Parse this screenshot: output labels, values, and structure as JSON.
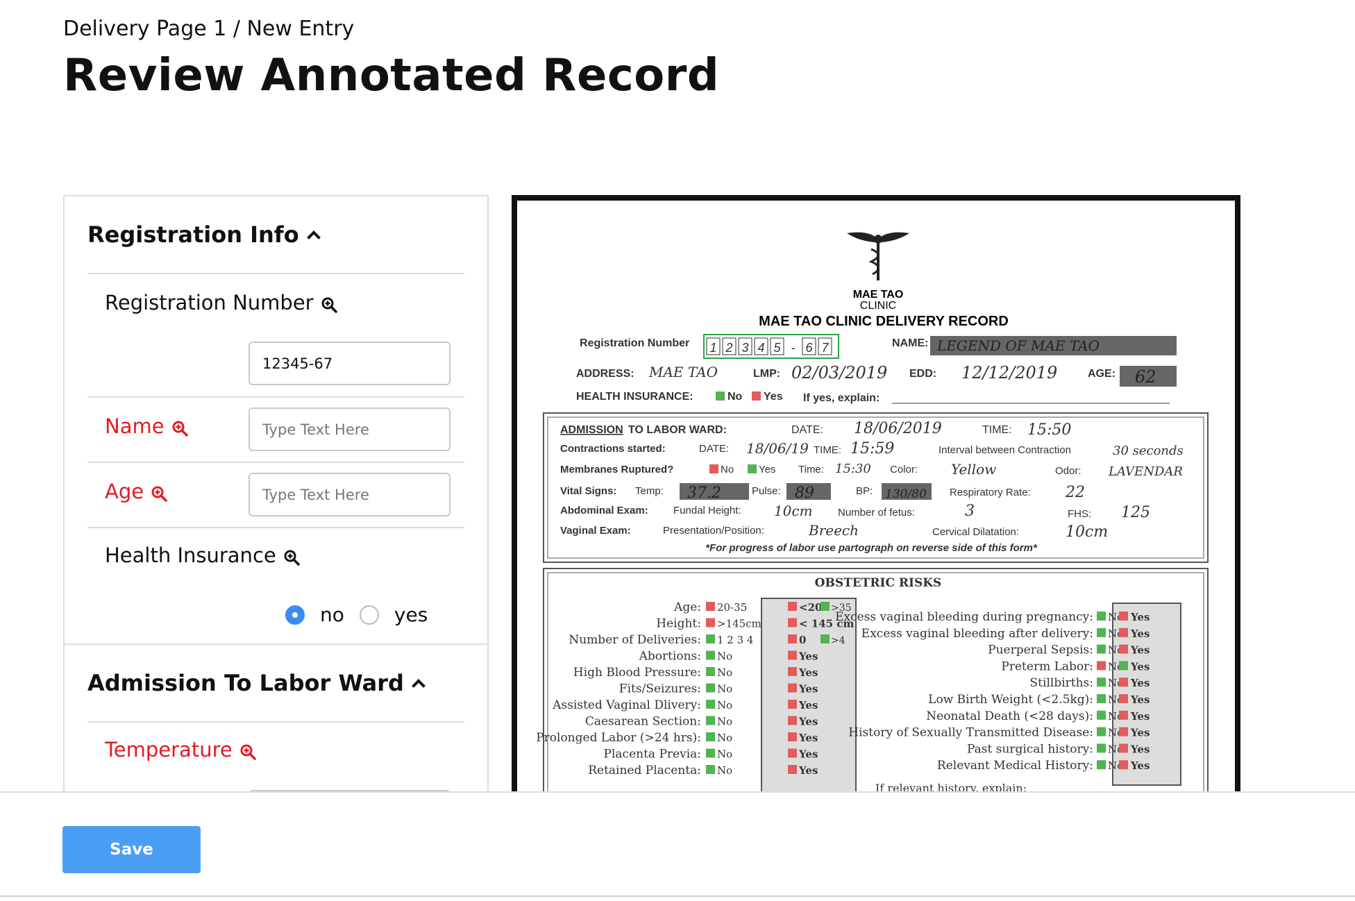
{
  "breadcrumb": "Delivery Page 1 / New Entry",
  "page_title": "Review Annotated Record",
  "registration_section": {
    "title": "Registration Info",
    "fields": {
      "registration_number": {
        "label": "Registration Number",
        "value": "12345-67"
      },
      "name": {
        "label": "Name",
        "placeholder": "Type Text Here"
      },
      "age": {
        "label": "Age",
        "placeholder": "Type Text Here"
      },
      "health_insurance": {
        "label": "Health Insurance",
        "options": [
          "no",
          "yes"
        ],
        "selected": "no"
      }
    }
  },
  "admission_section": {
    "title": "Admission To Labor Ward",
    "fields": {
      "temperature": {
        "label": "Temperature"
      }
    }
  },
  "save_label": "Save",
  "colors": {
    "accent": "#4a9ff5",
    "required": "#e31b23",
    "radio_selected": "#3b8cf2"
  },
  "document": {
    "clinic_name_1": "MAE TAO",
    "clinic_name_2": "CLINIC",
    "form_title": "MAE TAO CLINIC DELIVERY RECORD",
    "reg_label": "Registration Number",
    "reg_boxes": [
      "1",
      "2",
      "3",
      "4",
      "5",
      "-",
      "6",
      "7"
    ],
    "name_label": "NAME:",
    "name_value": "LEGEND OF MAE TAO",
    "address_label": "ADDRESS:",
    "address_value": "MAE TAO",
    "lmp_label": "LMP:",
    "lmp_value": "02/03/2019",
    "edd_label": "EDD:",
    "edd_value": "12/12/2019",
    "age_label": "AGE:",
    "age_value": "62",
    "hi_label": "HEALTH INSURANCE:",
    "hi_no": "No",
    "hi_yes": "Yes",
    "hi_explain": "If yes, explain:",
    "adm_title": "ADMISSION",
    "adm_title_rest": "TO LABOR WARD:",
    "date_label": "DATE:",
    "date_value": "18/06/2019",
    "time_label": "TIME:",
    "time_value": "15:50",
    "contr_label": "Contractions started:",
    "contr_date_label": "DATE:",
    "contr_date": "18/06/19",
    "contr_time_label": "TIME:",
    "contr_time": "15:59",
    "interval_label": "Interval between Contraction",
    "interval_value": "30 seconds",
    "membranes_label": "Membranes Ruptured?",
    "mem_no": "No",
    "mem_yes": "Yes",
    "mem_time_label": "Time:",
    "mem_time": "15:30",
    "color_label": "Color:",
    "color_value": "Yellow",
    "odor_label": "Odor:",
    "odor_value": "LAVENDAR",
    "vital_label": "Vital Signs:",
    "temp_label": "Temp:",
    "temp_value": "37.2",
    "pulse_label": "Pulse:",
    "pulse_value": "89",
    "bp_label": "BP:",
    "bp_value": "130/80",
    "resp_label": "Respiratory Rate:",
    "resp_value": "22",
    "abd_label": "Abdominal Exam:",
    "fundal_label": "Fundal Height:",
    "fundal_value": "10cm",
    "fetus_label": "Number of fetus:",
    "fetus_value": "3",
    "fhs_label": "FHS:",
    "fhs_value": "125",
    "vag_label": "Vaginal Exam:",
    "pres_label": "Presentation/Position:",
    "pres_value": "Breech",
    "cerv_label": "Cervical Dilatation:",
    "cerv_value": "10cm",
    "progress_note": "*For progress of labor use partograph on reverse side of this form*",
    "risks_title": "OBSTETRIC RISKS",
    "risks_left": [
      {
        "label": "Age:",
        "low": "20-35",
        "high": "<20",
        "high2": ">35"
      },
      {
        "label": "Height:",
        "low": ">145cm",
        "high": "< 145 cm"
      },
      {
        "label": "Number of Deliveries:",
        "low": "1 2 3 4",
        "high": "0",
        "high2": ">4"
      },
      {
        "label": "Abortions:",
        "low": "No",
        "high": "Yes"
      },
      {
        "label": "High Blood Pressure:",
        "low": "No",
        "high": "Yes"
      },
      {
        "label": "Fits/Seizures:",
        "low": "No",
        "high": "Yes"
      },
      {
        "label": "Assisted Vaginal Dlivery:",
        "low": "No",
        "high": "Yes"
      },
      {
        "label": "Caesarean Section:",
        "low": "No",
        "high": "Yes"
      },
      {
        "label": "Prolonged Labor (>24 hrs):",
        "low": "No",
        "high": "Yes"
      },
      {
        "label": "Placenta Previa:",
        "low": "No",
        "high": "Yes"
      },
      {
        "label": "Retained Placenta:",
        "low": "No",
        "high": "Yes"
      }
    ],
    "risks_right": [
      {
        "label": "Excess vaginal bleeding during pregnancy:",
        "low": "No",
        "high": "Yes"
      },
      {
        "label": "Excess vaginal bleeding after delivery:",
        "low": "No",
        "high": "Yes"
      },
      {
        "label": "Puerperal Sepsis:",
        "low": "No",
        "high": "Yes"
      },
      {
        "label": "Preterm Labor:",
        "low": "No",
        "high": "Yes"
      },
      {
        "label": "Stillbirths:",
        "low": "No",
        "high": "Yes"
      },
      {
        "label": "Low Birth Weight (<2.5kg):",
        "low": "No",
        "high": "Yes"
      },
      {
        "label": "Neonatal Death (<28 days):",
        "low": "No",
        "high": "Yes"
      },
      {
        "label": "History of Sexually Transmitted Disease:",
        "low": "No",
        "high": "Yes"
      },
      {
        "label": "Past surgical history:",
        "low": "No",
        "high": "Yes"
      },
      {
        "label": "Relevant Medical History:",
        "low": "No",
        "high": "Yes"
      }
    ],
    "relevant_explain": "If relevant history, explain:"
  }
}
